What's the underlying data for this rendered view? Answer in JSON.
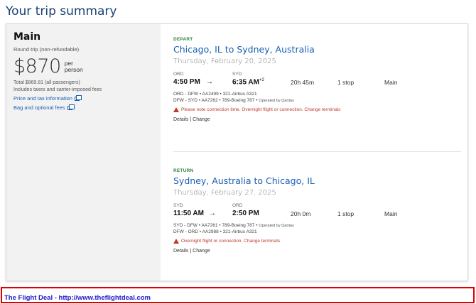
{
  "page": {
    "title": "Your trip summary"
  },
  "summary": {
    "fare_name": "Main",
    "trip_type": "Round trip (non-refundable)",
    "price": "$870",
    "per_person_line1": "per",
    "per_person_line2": "person",
    "total": "Total $869.81 (all passengers)",
    "includes": "Includes taxes and carrier-imposed fees",
    "links": {
      "price_tax": "Price and tax information",
      "bag_fees": "Bag and optional fees"
    }
  },
  "depart": {
    "label": "DEPART",
    "route": "Chicago, IL to Sydney, Australia",
    "date": "Thursday, February 20, 2025",
    "origin_code": "ORD",
    "dest_code": "SYD",
    "depart_time": "4:50 PM",
    "arrow": "→",
    "arrive_time": "6:35 AM",
    "plus_days": "+2",
    "duration": "20h 45m",
    "stops": "1 stop",
    "cabin": "Main",
    "leg1": "ORD - DFW • AA2499 • 321-Airbus A321",
    "leg2": "DFW - SYD • AA7262 • 789-Boeing 787 •",
    "leg2_operator": "Operated by Qantas",
    "warning": "Please note connection time. Overnight flight or connection. Change terminals",
    "details": "Details",
    "separator": "|",
    "change": "Change"
  },
  "return": {
    "label": "RETURN",
    "route": "Sydney, Australia to Chicago, IL",
    "date": "Thursday, February 27, 2025",
    "origin_code": "SYD",
    "dest_code": "ORD",
    "depart_time": "11:50 AM",
    "arrow": "→",
    "arrive_time": "2:50 PM",
    "duration": "20h 0m",
    "stops": "1 stop",
    "cabin": "Main",
    "leg1": "SYD - DFW • AA7261 • 789-Boeing 787 •",
    "leg1_operator": "Operated by Qantas",
    "leg2": "DFW - ORD • AA2988 • 321-Airbus A321",
    "warning": "Overnight flight or connection. Change terminals",
    "details": "Details",
    "separator": "|",
    "change": "Change"
  },
  "footer": {
    "text": "The Flight Deal - http://www.theflightdeal.com"
  },
  "colors": {
    "accent_blue": "#1a5fb4",
    "title_blue": "#1a3f73",
    "green": "#2e8540",
    "warning_red": "#c0392b",
    "footer_border": "#e00000"
  }
}
